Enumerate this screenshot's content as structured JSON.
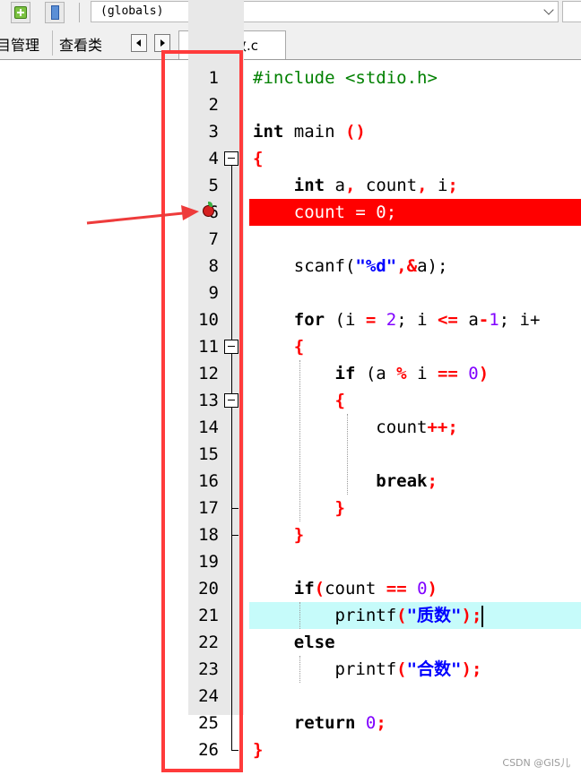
{
  "toolbar": {
    "add_icon": "plus-icon",
    "file_icon": "file-icon",
    "scope_dropdown_value": "(globals)"
  },
  "panel_tabs": [
    "目管理",
    "查看类"
  ],
  "file_tab": "判断质数.c",
  "watermark": "CSDN @GIS儿",
  "colors": {
    "breakpoint_line": "#ff0000",
    "current_line": "#c6fbfa",
    "annotation_frame": "#ff3b3b",
    "keyword": "#000000",
    "preprocessor": "#008000",
    "operator": "#ff0000",
    "number": "#8000ff",
    "string": "#0000ff"
  },
  "code": {
    "line_numbers": [
      "1",
      "2",
      "3",
      "4",
      "5",
      "6",
      "7",
      "8",
      "9",
      "10",
      "11",
      "12",
      "13",
      "14",
      "15",
      "16",
      "17",
      "18",
      "19",
      "20",
      "21",
      "22",
      "23",
      "24",
      "25",
      "26"
    ],
    "l1": "#include <stdio.h>",
    "l3_kw": "int",
    "l3_fn": " main ",
    "l3_p": "()",
    "l4": "{",
    "l5_kw": "int",
    "l5_a": " a",
    "l5_c1": ",",
    "l5_b": " count",
    "l5_c2": ",",
    "l5_i": " i",
    "l5_s": ";",
    "l6": "count = 0;",
    "l8_a": "scanf(",
    "l8_s": "\"%d\"",
    "l8_op": ",&",
    "l8_b": "a);",
    "l10_kw": "for",
    "l10_a": " (i ",
    "l10_op1": "=",
    "l10_sp": " ",
    "l10_n1": "2",
    "l10_s1": "; i ",
    "l10_op2": "<=",
    "l10_b": " a",
    "l10_op3": "-",
    "l10_n2": "1",
    "l10_s2": "; i+",
    "l11": "{",
    "l12_kw": "if",
    "l12_a": " (a ",
    "l12_op1": "%",
    "l12_b": " i ",
    "l12_op2": "==",
    "l12_sp": " ",
    "l12_n": "0",
    "l12_c": ")",
    "l13": "{",
    "l14_a": "count",
    "l14_op": "++;",
    "l16_kw": "break",
    "l16_s": ";",
    "l17": "}",
    "l18": "}",
    "l20_kw": "if",
    "l20_p1": "(",
    "l20_a": "count ",
    "l20_op": "==",
    "l20_sp": " ",
    "l20_n": "0",
    "l20_p2": ")",
    "l21_a": "printf",
    "l21_p1": "(",
    "l21_s": "\"质数\"",
    "l21_p2": ");",
    "l22_kw": "else",
    "l23_a": "printf",
    "l23_p1": "(",
    "l23_s": "\"合数\"",
    "l23_p2": ");",
    "l25_kw": "return",
    "l25_sp": " ",
    "l25_n": "0",
    "l25_s": ";",
    "l26": "}"
  }
}
